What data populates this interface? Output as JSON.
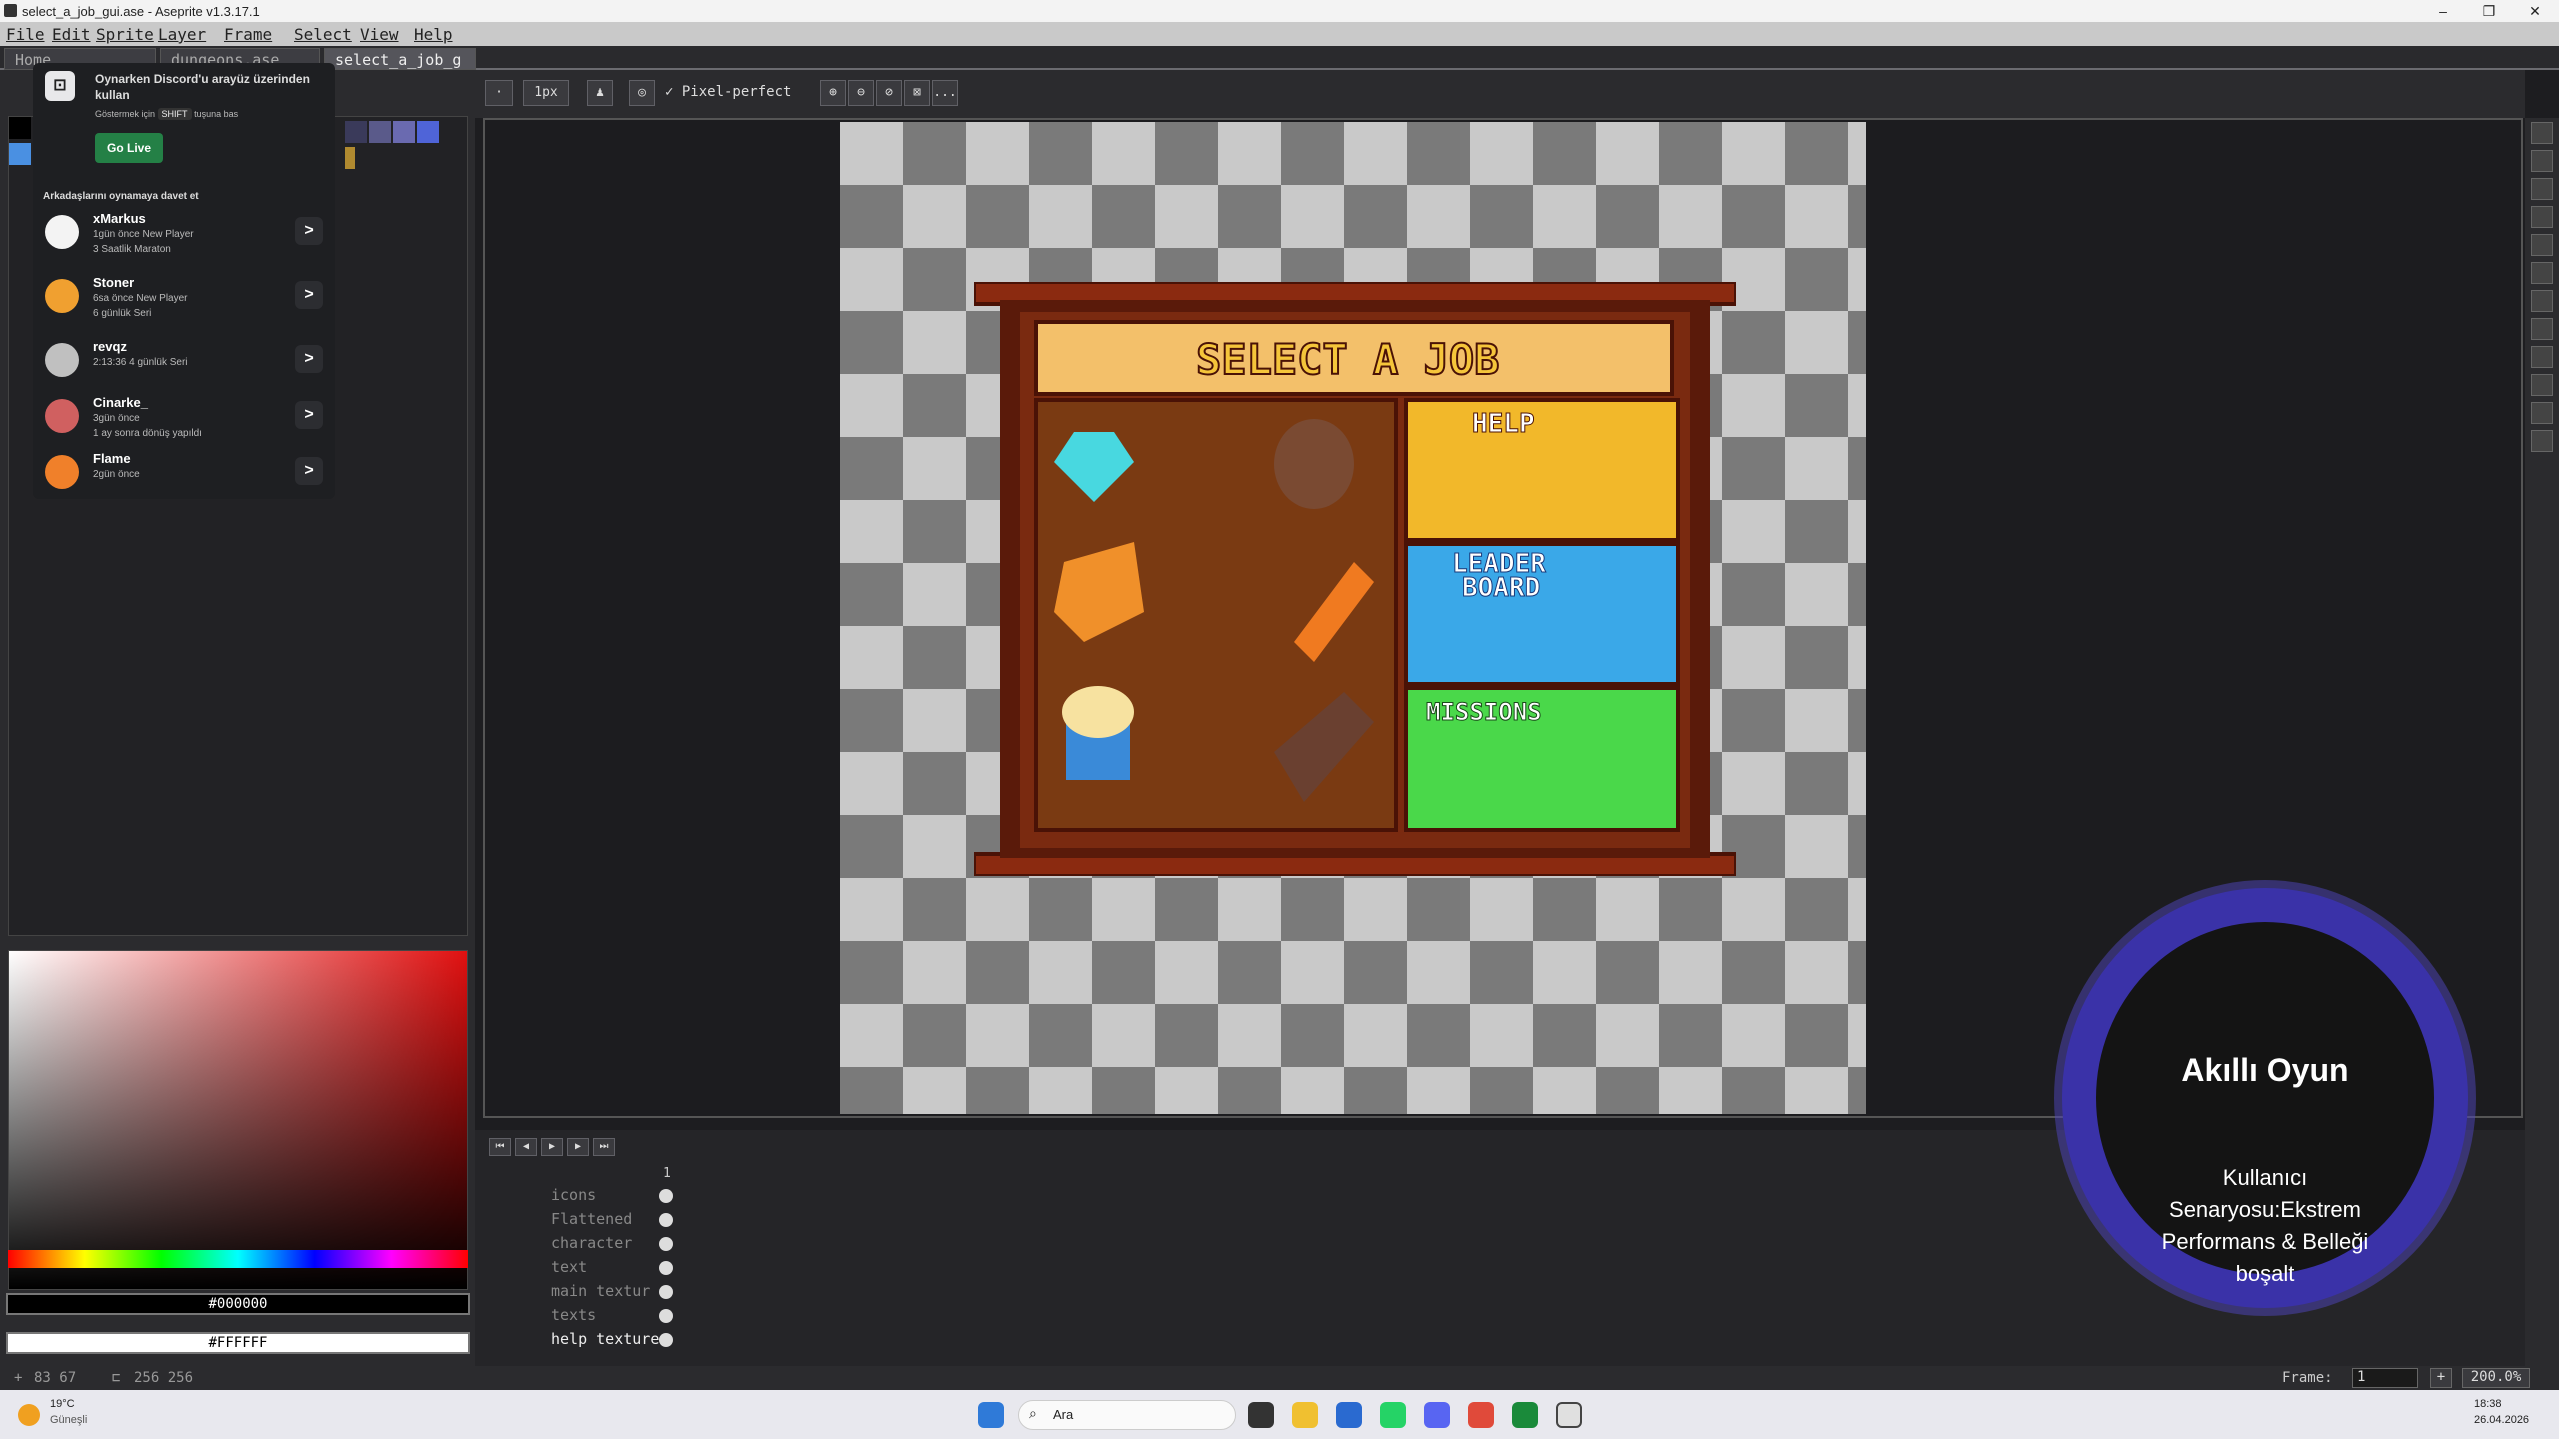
{
  "window": {
    "title": "select_a_job_gui.ase - Aseprite v1.3.17.1",
    "minimize": "–",
    "maximize": "❐",
    "close": "✕"
  },
  "menu": [
    "File",
    "Edit",
    "Sprite",
    "Layer",
    "Frame",
    "Select",
    "View",
    "Help"
  ],
  "tabs": [
    {
      "label": "Home"
    },
    {
      "label": "dungeons.ase"
    },
    {
      "label": "select_a_job_g"
    }
  ],
  "discord": {
    "message": "Oynarken Discord'u arayüz üzerinden kullan",
    "hint_prefix": "Göstermek için",
    "hint_key": "SHIFT",
    "hint_suffix": "tuşuna bas",
    "go_live": "Go Live",
    "invite_label": "Arkadaşlarını oynamaya davet et",
    "friends": [
      {
        "name": "xMarkus",
        "line1": "1gün önce   New Player",
        "line2": "3 Saatlik Maraton",
        "color": "#f3f3f3"
      },
      {
        "name": "Stoner",
        "line1": "6sa önce   New Player",
        "line2": "6 günlük Seri",
        "color": "#f0a030"
      },
      {
        "name": "revqz",
        "line1": "2:13:36   4 günlük Seri",
        "line2": "",
        "color": "#c0c0c0"
      },
      {
        "name": "Cinarke_",
        "line1": "3gün önce",
        "line2": "1 ay sonra dönüş yapıldı",
        "color": "#d06060"
      },
      {
        "name": "Flame",
        "line1": "2gün önce",
        "line2": "",
        "color": "#f0802a"
      }
    ]
  },
  "toolbar": {
    "brush_size": "1px",
    "pixel_perfect": "Pixel-perfect",
    "more": "..."
  },
  "colors": {
    "fg_hex": "#000000",
    "bg_hex": "#FFFFFF"
  },
  "palette": [
    "#000000",
    "#4a90e2",
    "#3a3a5a",
    "#5a5a8a",
    "#6a6ab0",
    "#4f64d8",
    "#b08a30"
  ],
  "layers": [
    {
      "name": "icons"
    },
    {
      "name": "Flattened"
    },
    {
      "name": "character"
    },
    {
      "name": "text"
    },
    {
      "name": "main textur"
    },
    {
      "name": "texts"
    },
    {
      "name": "help texture"
    }
  ],
  "timeline": {
    "frame_number": "1"
  },
  "status": {
    "coords": "83 67",
    "size": "256 256",
    "frame_label": "Frame:",
    "frame_value": "1",
    "zoom": "200.0%",
    "plus": "+"
  },
  "sprite_texts": {
    "title": "SELECT A JOB",
    "help": "HELP",
    "leader": "LEADER",
    "board": "BOARD",
    "missions": "MISSIONS"
  },
  "overlay": {
    "title": "Akıllı Oyun",
    "body": "Kullanıcı Senaryosu:Ekstrem Performans & Belleği boşalt"
  },
  "taskbar": {
    "weather_temp": "19°C",
    "weather_desc": "Güneşli",
    "search": "Ara",
    "time": "18:38",
    "date": "26.04.2026"
  }
}
